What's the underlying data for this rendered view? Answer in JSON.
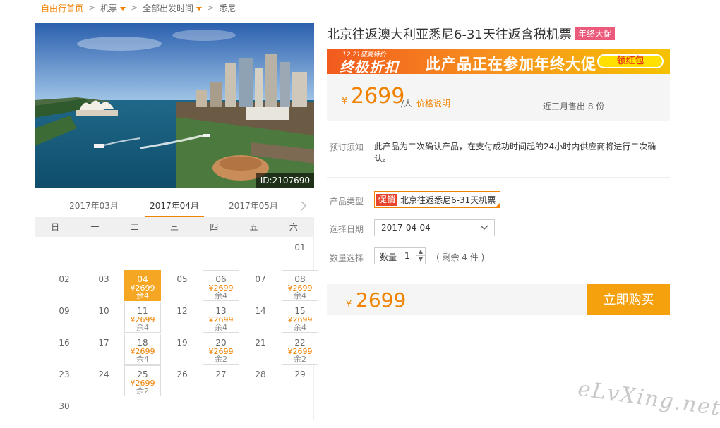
{
  "breadcrumb": {
    "home": "自由行首页",
    "sep": ">",
    "items": [
      "机票",
      "全部出发时间",
      "悉尼"
    ]
  },
  "photo": {
    "id_label": "ID:2107690"
  },
  "calendar": {
    "months": [
      "2017年03月",
      "2017年04月",
      "2017年05月"
    ],
    "active_month": "2017年04月",
    "weekdays": [
      "日",
      "一",
      "二",
      "三",
      "四",
      "五",
      "六"
    ],
    "days": [
      {
        "d": "01"
      },
      {
        "d": "02"
      },
      {
        "d": "03"
      },
      {
        "d": "04",
        "price": "¥2699",
        "left": "余4",
        "selected": true
      },
      {
        "d": "05"
      },
      {
        "d": "06",
        "price": "¥2699",
        "left": "余4"
      },
      {
        "d": "07"
      },
      {
        "d": "08",
        "price": "¥2699",
        "left": "余4"
      },
      {
        "d": "09"
      },
      {
        "d": "10"
      },
      {
        "d": "11",
        "price": "¥2699",
        "left": "余4"
      },
      {
        "d": "12"
      },
      {
        "d": "13",
        "price": "¥2699",
        "left": "余4"
      },
      {
        "d": "14"
      },
      {
        "d": "15",
        "price": "¥2699",
        "left": "余4"
      },
      {
        "d": "16"
      },
      {
        "d": "17"
      },
      {
        "d": "18",
        "price": "¥2699",
        "left": "余4"
      },
      {
        "d": "19"
      },
      {
        "d": "20",
        "price": "¥2699",
        "left": "余2"
      },
      {
        "d": "21"
      },
      {
        "d": "22",
        "price": "¥2699",
        "left": "余2"
      },
      {
        "d": "23"
      },
      {
        "d": "24"
      },
      {
        "d": "25",
        "price": "¥2699",
        "left": "余2"
      },
      {
        "d": "26"
      },
      {
        "d": "27"
      },
      {
        "d": "28"
      },
      {
        "d": "29"
      },
      {
        "d": "30"
      }
    ]
  },
  "product": {
    "title": "北京往返澳大利亚悉尼6-31天往返含税机票",
    "title_tag": "年终大促",
    "banner": {
      "small": "12.21盛夏特价",
      "main": "终极折扣",
      "text": "此产品正在参加年终大促",
      "button": "领红包"
    },
    "price": {
      "currency": "¥",
      "amount": "2699",
      "unit": "/人",
      "note": "价格说明",
      "sold": "近三月售出 8 份"
    },
    "notice_label": "预订须知",
    "notice_text": "此产品为二次确认产品，在支付成功时间起的24小时内供应商将进行二次确认。",
    "type_label": "产品类型",
    "type_promo": "促销",
    "type_name": "北京往返悉尼6-31天机票",
    "date_label": "选择日期",
    "date_value": "2017-04-04",
    "qty_label": "数量选择",
    "qty_field_label": "数量",
    "qty_value": "1",
    "qty_up": "▲",
    "qty_down": "▼",
    "remaining": "( 剩余 4 件 )",
    "total_currency": "¥",
    "total_amount": "2699",
    "buy_label": "立即购买"
  },
  "watermark": "eLvXing.net"
}
